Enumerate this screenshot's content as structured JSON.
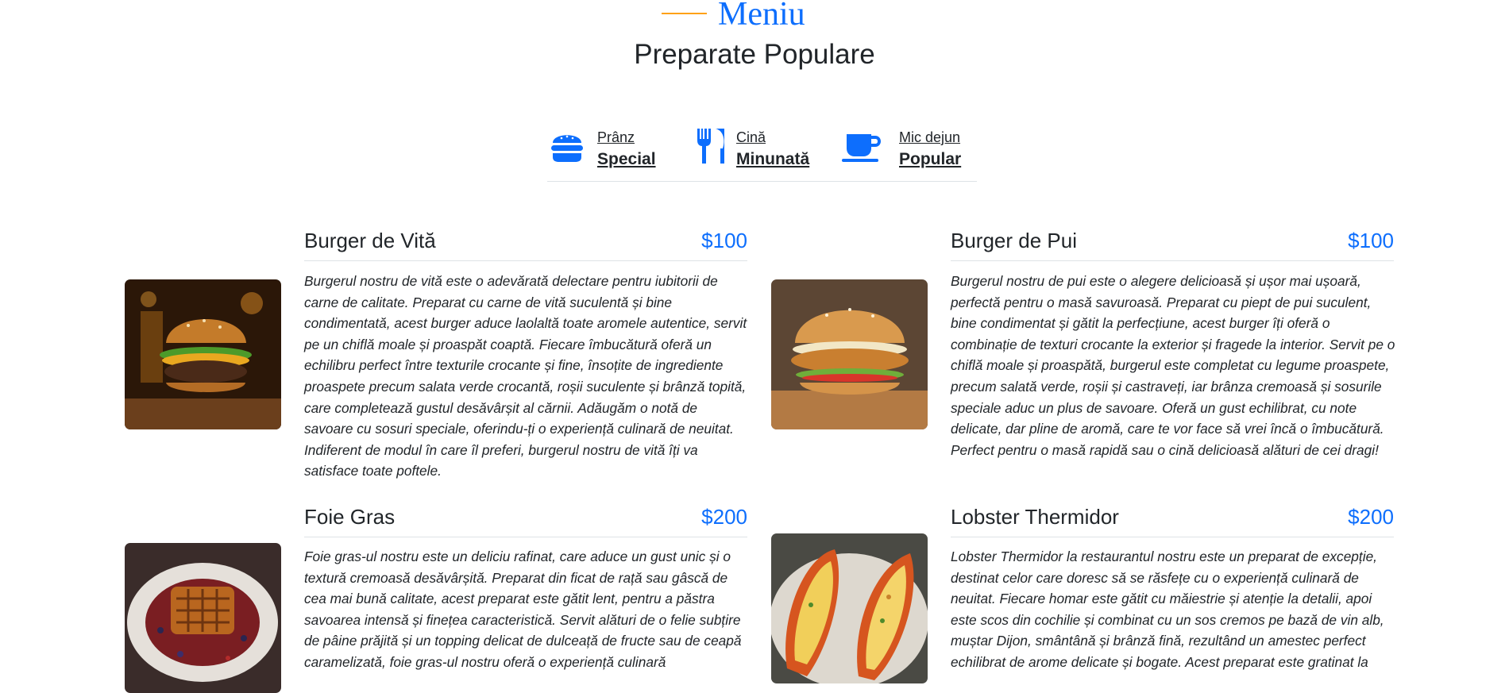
{
  "header": {
    "subtitle": "Meniu",
    "title": "Preparate Populare"
  },
  "tabs": [
    {
      "icon": "hamburger-icon",
      "small": "Prânz",
      "big": "Special"
    },
    {
      "icon": "utensils-icon",
      "small": "Cină",
      "big": "Minunată"
    },
    {
      "icon": "coffee-cup-icon",
      "small": "Mic dejun",
      "big": "Popular"
    }
  ],
  "menu": [
    {
      "name": "Burger de Vită",
      "price": "$100",
      "image": "beef-burger-photo",
      "description": "Burgerul nostru de vită este o adevărată delectare pentru iubitorii de carne de calitate. Preparat cu carne de vită suculentă și bine condimentată, acest burger aduce laolaltă toate aromele autentice, servit pe un chiflă moale și proaspăt coaptă. Fiecare îmbucătură oferă un echilibru perfect între texturile crocante și fine, însoțite de ingrediente proaspete precum salata verde crocantă, roșii suculente și brânză topită, care completează gustul desăvârșit al cărnii. Adăugăm o notă de savoare cu sosuri speciale, oferindu-ți o experiență culinară de neuitat. Indiferent de modul în care îl preferi, burgerul nostru de vită îți va satisface toate poftele."
    },
    {
      "name": "Burger de Pui",
      "price": "$100",
      "image": "chicken-burger-photo",
      "description": "Burgerul nostru de pui este o alegere delicioasă și ușor mai ușoară, perfectă pentru o masă savuroasă. Preparat cu piept de pui suculent, bine condimentat și gătit la perfecțiune, acest burger îți oferă o combinație de texturi crocante la exterior și fragede la interior. Servit pe o chiflă moale și proaspătă, burgerul este completat cu legume proaspete, precum salată verde, roșii și castraveți, iar brânza cremoasă și sosurile speciale aduc un plus de savoare. Oferă un gust echilibrat, cu note delicate, dar pline de aromă, care te vor face să vrei încă o îmbucătură. Perfect pentru o masă rapidă sau o cină delicioasă alături de cei dragi!"
    },
    {
      "name": "Foie Gras",
      "price": "$200",
      "image": "foie-gras-photo",
      "description": "Foie gras-ul nostru este un deliciu rafinat, care aduce un gust unic și o textură cremoasă desăvârșită. Preparat din ficat de rață sau gâscă de cea mai bună calitate, acest preparat este gătit lent, pentru a păstra savoarea intensă și finețea caracteristică. Servit alături de o felie subțire de pâine prăjită și un topping delicat de dulceață de fructe sau de ceapă caramelizată, foie gras-ul nostru oferă o experiență culinară"
    },
    {
      "name": "Lobster Thermidor",
      "price": "$200",
      "image": "lobster-thermidor-photo",
      "description": "Lobster Thermidor la restaurantul nostru este un preparat de excepție, destinat celor care doresc să se răsfețe cu o experiență culinară de neuitat. Fiecare homar este gătit cu măiestrie și atenție la detalii, apoi este scos din cochilie și combinat cu un sos cremos pe bază de vin alb, muștar Dijon, smântână și brânză fină, rezultând un amestec perfect echilibrat de arome delicate și bogate. Acest preparat este gratinat la"
    }
  ],
  "colors": {
    "accent": "#0d6efd",
    "subtitle_line": "#fea116",
    "text": "#212529",
    "divider": "#dee2e6"
  }
}
